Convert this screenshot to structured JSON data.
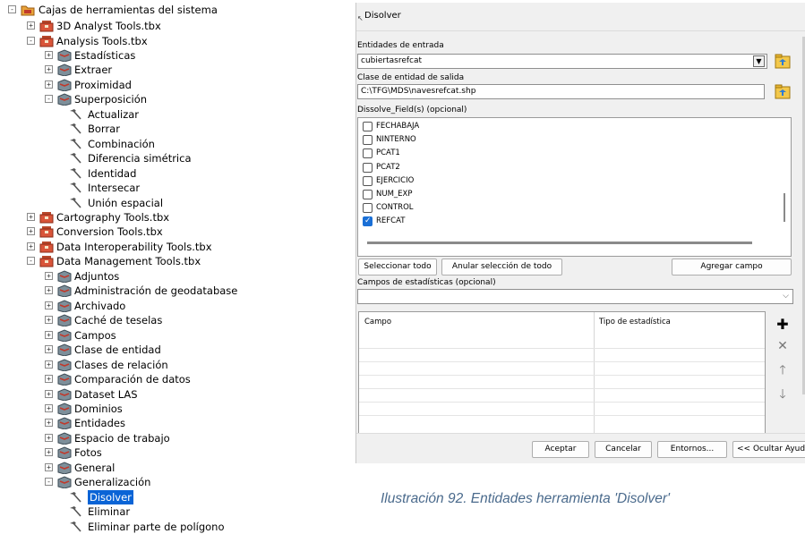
{
  "tree": {
    "root": "Cajas de herramientas del sistema",
    "items": [
      {
        "label": "3D Analyst Tools.tbx",
        "kind": "toolbox",
        "expander": "+",
        "level": 1
      },
      {
        "label": "Analysis Tools.tbx",
        "kind": "toolbox",
        "expander": "-",
        "level": 1
      },
      {
        "label": "Estadísticas",
        "kind": "toolset",
        "expander": "+",
        "level": 2
      },
      {
        "label": "Extraer",
        "kind": "toolset",
        "expander": "+",
        "level": 2
      },
      {
        "label": "Proximidad",
        "kind": "toolset",
        "expander": "+",
        "level": 2
      },
      {
        "label": "Superposición",
        "kind": "toolset",
        "expander": "-",
        "level": 2
      },
      {
        "label": "Actualizar",
        "kind": "tool",
        "expander": "",
        "level": 3
      },
      {
        "label": "Borrar",
        "kind": "tool",
        "expander": "",
        "level": 3
      },
      {
        "label": "Combinación",
        "kind": "tool",
        "expander": "",
        "level": 3
      },
      {
        "label": "Diferencia simétrica",
        "kind": "tool",
        "expander": "",
        "level": 3
      },
      {
        "label": "Identidad",
        "kind": "tool",
        "expander": "",
        "level": 3
      },
      {
        "label": "Intersecar",
        "kind": "tool",
        "expander": "",
        "level": 3
      },
      {
        "label": "Unión espacial",
        "kind": "tool",
        "expander": "",
        "level": 3
      },
      {
        "label": "Cartography Tools.tbx",
        "kind": "toolbox",
        "expander": "+",
        "level": 1
      },
      {
        "label": "Conversion Tools.tbx",
        "kind": "toolbox",
        "expander": "+",
        "level": 1
      },
      {
        "label": "Data Interoperability Tools.tbx",
        "kind": "toolbox",
        "expander": "+",
        "level": 1
      },
      {
        "label": "Data Management Tools.tbx",
        "kind": "toolbox",
        "expander": "-",
        "level": 1
      },
      {
        "label": "Adjuntos",
        "kind": "toolset",
        "expander": "+",
        "level": 2
      },
      {
        "label": "Administración de geodatabase",
        "kind": "toolset",
        "expander": "+",
        "level": 2
      },
      {
        "label": "Archivado",
        "kind": "toolset",
        "expander": "+",
        "level": 2
      },
      {
        "label": "Caché de teselas",
        "kind": "toolset",
        "expander": "+",
        "level": 2
      },
      {
        "label": "Campos",
        "kind": "toolset",
        "expander": "+",
        "level": 2
      },
      {
        "label": "Clase de entidad",
        "kind": "toolset",
        "expander": "+",
        "level": 2
      },
      {
        "label": "Clases de relación",
        "kind": "toolset",
        "expander": "+",
        "level": 2
      },
      {
        "label": "Comparación de datos",
        "kind": "toolset",
        "expander": "+",
        "level": 2
      },
      {
        "label": "Dataset LAS",
        "kind": "toolset",
        "expander": "+",
        "level": 2
      },
      {
        "label": "Dominios",
        "kind": "toolset",
        "expander": "+",
        "level": 2
      },
      {
        "label": "Entidades",
        "kind": "toolset",
        "expander": "+",
        "level": 2
      },
      {
        "label": "Espacio de trabajo",
        "kind": "toolset",
        "expander": "+",
        "level": 2
      },
      {
        "label": "Fotos",
        "kind": "toolset",
        "expander": "+",
        "level": 2
      },
      {
        "label": "General",
        "kind": "toolset",
        "expander": "+",
        "level": 2
      },
      {
        "label": "Generalización",
        "kind": "toolset",
        "expander": "-",
        "level": 2
      },
      {
        "label": "Disolver",
        "kind": "tool",
        "expander": "",
        "level": 3,
        "selected": true
      },
      {
        "label": "Eliminar",
        "kind": "tool",
        "expander": "",
        "level": 3
      },
      {
        "label": "Eliminar parte de polígono",
        "kind": "tool",
        "expander": "",
        "level": 3
      }
    ]
  },
  "dialog": {
    "title": "Disolver",
    "input_label": "Entidades de entrada",
    "input_value": "cubiertasrefcat",
    "output_label": "Clase de entidad de salida",
    "output_value": "C:\\TFG\\MDS\\navesrefcat.shp",
    "dissolve_label": "Dissolve_Field(s) (opcional)",
    "fields": [
      {
        "name": "FECHABAJA",
        "checked": false
      },
      {
        "name": "NINTERNO",
        "checked": false
      },
      {
        "name": "PCAT1",
        "checked": false
      },
      {
        "name": "PCAT2",
        "checked": false
      },
      {
        "name": "EJERCICIO",
        "checked": false
      },
      {
        "name": "NUM_EXP",
        "checked": false
      },
      {
        "name": "CONTROL",
        "checked": false
      },
      {
        "name": "REFCAT",
        "checked": true
      }
    ],
    "select_all": "Seleccionar todo",
    "unselect_all": "Anular selección de todo",
    "add_field": "Agregar campo",
    "stats_label": "Campos de estadísticas (opcional)",
    "stats_value": "",
    "col_field": "Campo",
    "col_stat": "Tipo de estadística",
    "ok": "Aceptar",
    "cancel": "Cancelar",
    "env": "Entornos...",
    "hide_help": "<< Ocultar Ayuda"
  },
  "caption": "Ilustración 92. Entidades herramienta 'Disolver'"
}
